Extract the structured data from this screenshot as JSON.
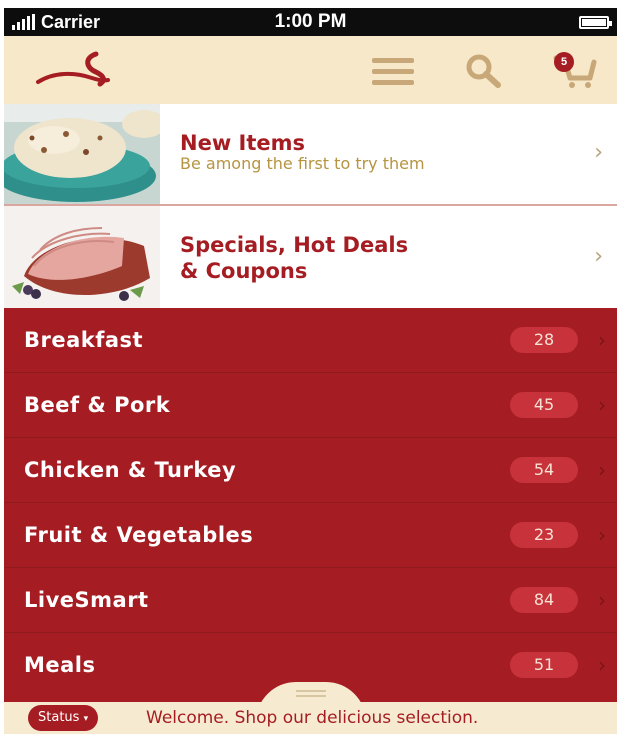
{
  "status_bar": {
    "carrier": "Carrier",
    "time": "1:00 PM"
  },
  "header": {
    "cart_count": "5"
  },
  "features": [
    {
      "title": "New Items",
      "subtitle": "Be among the first to try them"
    },
    {
      "title_line1": "Specials, Hot Deals",
      "title_line2": "& Coupons"
    }
  ],
  "categories": [
    {
      "label": "Breakfast",
      "count": "28"
    },
    {
      "label": "Beef & Pork",
      "count": "45"
    },
    {
      "label": "Chicken & Turkey",
      "count": "54"
    },
    {
      "label": "Fruit & Vegetables",
      "count": "23"
    },
    {
      "label": "LiveSmart",
      "count": "84"
    },
    {
      "label": "Meals",
      "count": "51"
    }
  ],
  "footer": {
    "status_label": "Status",
    "message": "Welcome. Shop our delicious selection."
  },
  "colors": {
    "brand_red": "#a51d22",
    "cream": "#f6e8c8",
    "gold_text": "#b69440",
    "count_pill": "#c8323a"
  },
  "icons": [
    "logo-swoosh-icon",
    "menu-icon",
    "search-icon",
    "cart-icon",
    "chevron-right-icon",
    "caret-down-icon"
  ]
}
